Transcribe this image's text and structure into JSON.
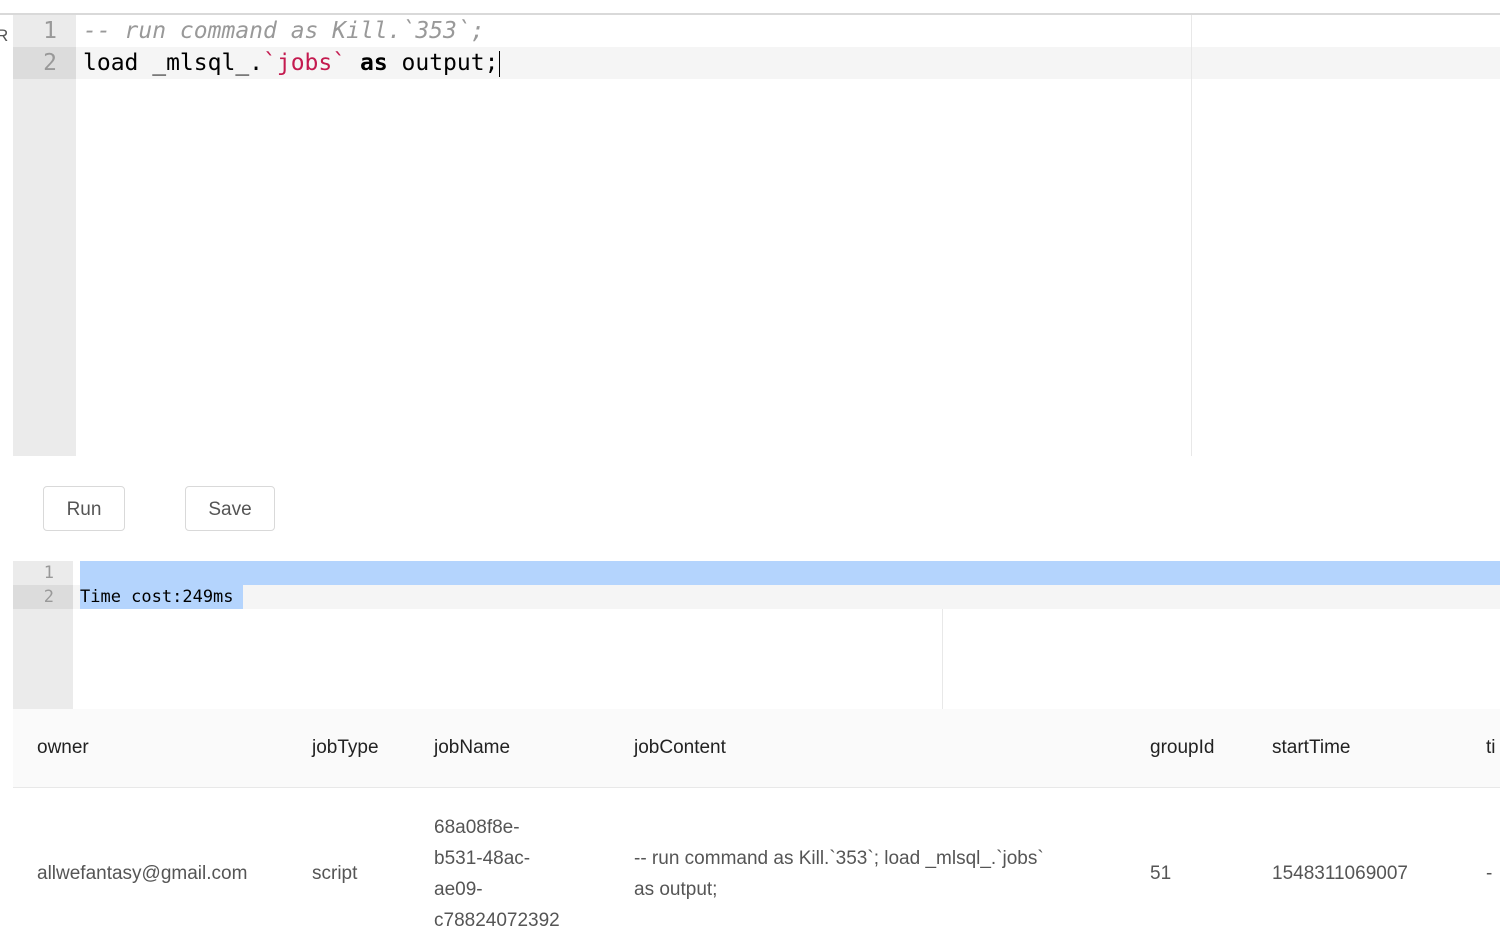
{
  "left_edge_glyph": "R",
  "editor": {
    "line_numbers": [
      "1",
      "2"
    ],
    "line1": {
      "comment": "-- run command as Kill.`353`;"
    },
    "line2": {
      "part1": "load _mlsql_.",
      "string": "`jobs`",
      "part2": " ",
      "keyword": "as",
      "part3": " output;"
    }
  },
  "buttons": {
    "run_label": "Run",
    "save_label": "Save"
  },
  "console": {
    "line_numbers": [
      "1",
      "2"
    ],
    "output_text": "Time cost:249ms"
  },
  "table": {
    "columns": [
      "owner",
      "jobType",
      "jobName",
      "jobContent",
      "groupId",
      "startTime",
      "ti"
    ],
    "row": {
      "owner": "allwefantasy@gmail.com",
      "jobType": "script",
      "jobName_lines": [
        "68a08f8e-",
        "b531-48ac-",
        "ae09-",
        "c78824072392"
      ],
      "jobContent_lines": [
        "-- run command as Kill.`353`; load _mlsql_.`jobs`",
        "as output;"
      ],
      "groupId": "51",
      "startTime": "1548311069007",
      "timeout": "-"
    }
  },
  "colors": {
    "gutter": "#ebebeb",
    "selection": "#b4d4fd",
    "string_token": "#c41a4f",
    "comment_token": "#999999"
  }
}
